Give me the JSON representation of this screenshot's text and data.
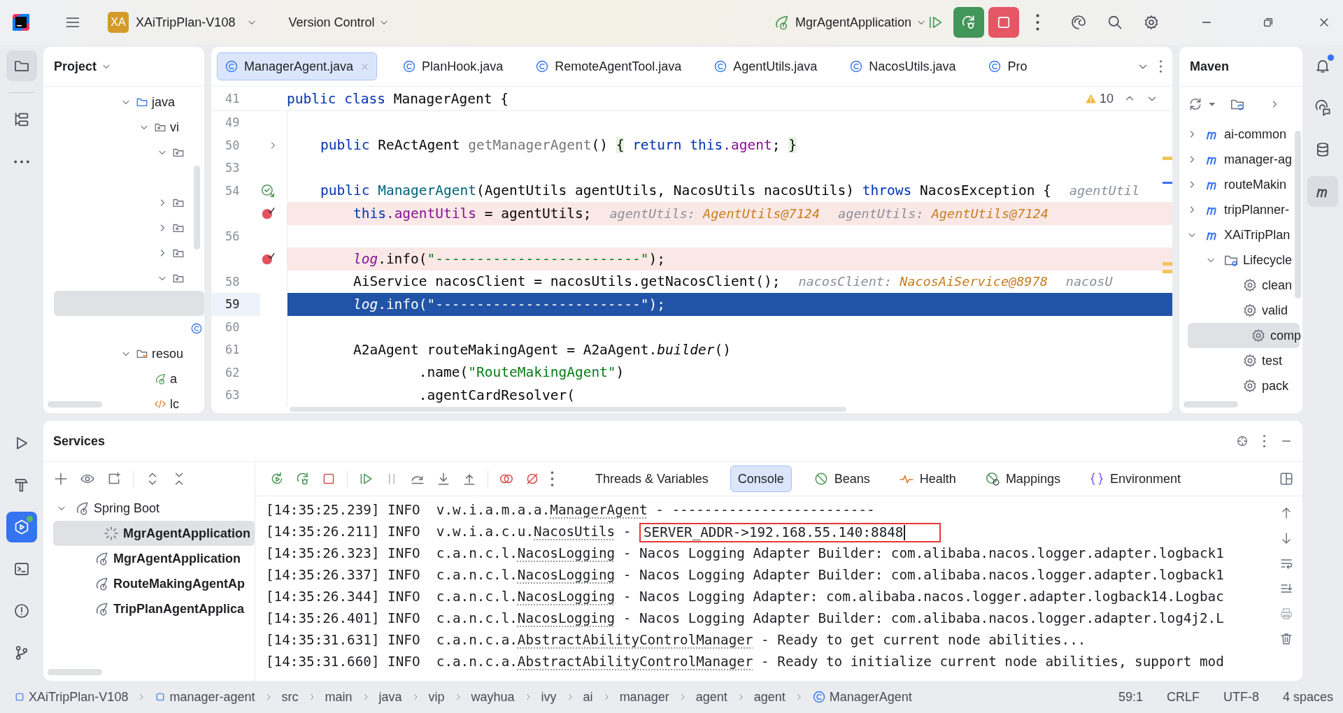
{
  "title_bar": {
    "project_badge": "XA",
    "project": "XAiTripPlan-V108",
    "vcs": "Version Control",
    "run_configuration": "MgrAgentApplication"
  },
  "left_toolbar": {
    "top": [
      {
        "kind": "project",
        "selected": true,
        "badge": false
      },
      {
        "kind": "structure",
        "selected": false,
        "badge": false
      },
      {
        "kind": "more",
        "selected": false,
        "badge": false
      }
    ],
    "bottom": [
      {
        "kind": "run",
        "selected": false,
        "badge": false
      },
      {
        "kind": "build",
        "selected": false,
        "badge": false
      },
      {
        "kind": "services",
        "selected": true,
        "badge": true
      },
      {
        "kind": "terminal",
        "selected": false,
        "badge": false
      },
      {
        "kind": "problems",
        "selected": false,
        "badge": false
      },
      {
        "kind": "git",
        "selected": false,
        "badge": false
      }
    ]
  },
  "right_toolbar": [
    {
      "kind": "notifications",
      "selected": false,
      "badge": true
    },
    {
      "kind": "ai-chat",
      "selected": false,
      "badge": false
    },
    {
      "kind": "database",
      "selected": false,
      "badge": false
    },
    {
      "kind": "maven",
      "selected": true,
      "badge": false
    }
  ],
  "project_panel": {
    "title": "Project",
    "tree": [
      {
        "label": "java",
        "kind": "source-folder",
        "expanded": true,
        "selected": false,
        "children": [
          {
            "label": "vi",
            "kind": "package",
            "expanded": true,
            "selected": false,
            "children": [
              {
                "kind": "package",
                "expanded": true,
                "selected": false,
                "children": [
                  {
                    "selected": false
                  }
                ]
              },
              {
                "kind": "package",
                "expanded": false,
                "selected": false
              },
              {
                "kind": "package",
                "expanded": false,
                "selected": false
              },
              {
                "kind": "package",
                "expanded": false,
                "selected": false
              },
              {
                "kind": "package",
                "expanded": true,
                "selected": false,
                "children": [
                  {
                    "selected": true
                  },
                  {
                    "kind": "class",
                    "selected": false
                  }
                ]
              }
            ]
          }
        ]
      },
      {
        "label": "resou",
        "kind": "resource-folder",
        "expanded": true,
        "selected": false,
        "children": [
          {
            "label": "a",
            "kind": "spring-config",
            "selected": false
          },
          {
            "label": "lc",
            "kind": "xml",
            "selected": false
          }
        ]
      }
    ]
  },
  "editor": {
    "tabs": [
      {
        "label": "ManagerAgent.java",
        "selected": true
      },
      {
        "label": "PlanHook.java",
        "selected": false
      },
      {
        "label": "RemoteAgentTool.java",
        "selected": false
      },
      {
        "label": "AgentUtils.java",
        "selected": false
      },
      {
        "label": "NacosUtils.java",
        "selected": false
      },
      {
        "label": "Pro",
        "selected": false
      }
    ],
    "warnings": "10",
    "sticky_line": {
      "number": "41",
      "code": [
        {
          "kind": "keyword",
          "text": "public"
        },
        {
          "kind": "keyword",
          "text": " class"
        },
        {
          "kind": "plain",
          "text": " ManagerAgent {"
        }
      ]
    },
    "lines": [
      {
        "number": "49",
        "breakpoint": false,
        "execution_point": false
      },
      {
        "number": "50",
        "breakpoint": false,
        "execution_point": false,
        "gutter_icon": {
          "kind": "fold"
        },
        "code": [
          {
            "kind": "keyword",
            "text": "    public"
          },
          {
            "kind": "plain",
            "text": " ReActAgent "
          },
          {
            "kind": "unused",
            "text": "getManagerAgent"
          },
          {
            "kind": "plain",
            "text": "() "
          },
          {
            "kind": "fold",
            "text": "{"
          },
          {
            "kind": "keyword",
            "text": " return this"
          },
          {
            "kind": "field",
            "text": ".agent"
          },
          {
            "kind": "plain",
            "text": "; "
          },
          {
            "kind": "fold",
            "text": "}"
          }
        ]
      },
      {
        "number": "53",
        "breakpoint": false,
        "execution_point": false
      },
      {
        "number": "54",
        "breakpoint": false,
        "execution_point": false,
        "gutter_icon": {
          "kind": "override"
        },
        "code": [
          {
            "kind": "keyword",
            "text": "    public"
          },
          {
            "kind": "declaration",
            "text": " ManagerAgent"
          },
          {
            "kind": "plain",
            "text": "(AgentUtils agentUtils, NacosUtils nacosUtils) "
          },
          {
            "kind": "keyword",
            "text": "throws"
          },
          {
            "kind": "plain",
            "text": " NacosException {"
          }
        ],
        "hints": [
          {
            "label": "agentUtil"
          }
        ]
      },
      {
        "breakpoint": true,
        "execution_point": false,
        "code": [
          {
            "kind": "keyword",
            "text": "        this"
          },
          {
            "kind": "field",
            "text": ".agentUtils"
          },
          {
            "kind": "plain",
            "text": " = agentUtils;"
          }
        ],
        "hints": [
          {
            "label": "agentUtils:",
            "value": "AgentUtils@7124"
          },
          {
            "label": "agentUtils:",
            "value": "AgentUtils@7124"
          }
        ]
      },
      {
        "number": "56",
        "breakpoint": false,
        "execution_point": false
      },
      {
        "breakpoint": true,
        "execution_point": false,
        "code": [
          {
            "kind": "static",
            "text": "        log"
          },
          {
            "kind": "plain",
            "text": ".info("
          },
          {
            "kind": "string",
            "text": "\"-------------------------\""
          },
          {
            "kind": "plain",
            "text": ");"
          }
        ]
      },
      {
        "number": "58",
        "breakpoint": false,
        "execution_point": false,
        "code": [
          {
            "kind": "plain",
            "text": "        AiService nacosClient = nacosUtils.getNacosClient();"
          }
        ],
        "hints": [
          {
            "label": "nacosClient:",
            "value": "NacosAiService@8978"
          },
          {
            "label": "nacosU"
          }
        ]
      },
      {
        "number": "59",
        "breakpoint": false,
        "execution_point": true,
        "code": [
          {
            "kind": "static",
            "text": "        log"
          },
          {
            "kind": "plain",
            "text": ".info("
          },
          {
            "kind": "string",
            "text": "\"-------------------------\""
          },
          {
            "kind": "plain",
            "text": ");"
          }
        ]
      },
      {
        "number": "60",
        "breakpoint": false,
        "execution_point": false
      },
      {
        "number": "61",
        "breakpoint": false,
        "execution_point": false,
        "code": [
          {
            "kind": "plain",
            "text": "        A2aAgent routeMakingAgent = A2aAgent."
          },
          {
            "kind": "italic",
            "text": "builder"
          },
          {
            "kind": "plain",
            "text": "()"
          }
        ]
      },
      {
        "number": "62",
        "breakpoint": false,
        "execution_point": false,
        "code": [
          {
            "kind": "plain",
            "text": "                .name("
          },
          {
            "kind": "string",
            "text": "\"RouteMakingAgent\""
          },
          {
            "kind": "plain",
            "text": ")"
          }
        ]
      },
      {
        "number": "63",
        "breakpoint": false,
        "execution_point": false,
        "code": [
          {
            "kind": "plain",
            "text": "                .agentCardResolver("
          }
        ]
      }
    ]
  },
  "maven_panel": {
    "title": "Maven",
    "tree": [
      {
        "label": "ai-common",
        "kind": "module",
        "expanded": false,
        "selected": false
      },
      {
        "label": "manager-ag",
        "kind": "module",
        "expanded": false,
        "selected": false
      },
      {
        "label": "routeMakin",
        "kind": "module",
        "expanded": false,
        "selected": false
      },
      {
        "label": "tripPlanner-",
        "kind": "module",
        "expanded": false,
        "selected": false
      },
      {
        "label": "XAiTripPlan",
        "kind": "module",
        "expanded": true,
        "selected": false,
        "children": [
          {
            "label": "Lifecycle",
            "kind": "lifecycle",
            "expanded": true,
            "selected": false,
            "children": [
              {
                "label": "clean",
                "kind": "goal",
                "selected": false
              },
              {
                "label": "valid",
                "kind": "goal",
                "selected": false
              },
              {
                "label": "comp",
                "kind": "goal",
                "selected": true
              },
              {
                "label": "test",
                "kind": "goal",
                "selected": false
              },
              {
                "label": "pack",
                "kind": "goal",
                "selected": false
              }
            ]
          }
        ]
      }
    ]
  },
  "services_panel": {
    "title": "Services",
    "tree": [
      {
        "label": "Spring Boot",
        "kind": "spring-group",
        "expanded": true,
        "selected": false,
        "children": [
          {
            "label": "MgrAgentApplication",
            "kind": "app-running",
            "selected": true
          },
          {
            "label": "MgrAgentApplication",
            "kind": "app",
            "selected": false
          },
          {
            "label": "RouteMakingAgentAp",
            "kind": "app",
            "selected": false
          },
          {
            "label": "TripPlanAgentApplica",
            "kind": "app",
            "selected": false
          }
        ]
      }
    ],
    "console_tabs": [
      {
        "label": "Threads & Variables",
        "kind": "threads",
        "selected": false
      },
      {
        "label": "Console",
        "kind": "console",
        "selected": true
      },
      {
        "label": "Beans",
        "kind": "beans",
        "selected": false
      },
      {
        "label": "Health",
        "kind": "health",
        "selected": false
      },
      {
        "label": "Mappings",
        "kind": "mappings",
        "selected": false
      },
      {
        "label": "Environment",
        "kind": "environment",
        "selected": false
      }
    ],
    "console": [
      {
        "prefix": "[14:35:25.239] INFO  v.w.i.a.m.a.a.",
        "link": "ManagerAgent",
        "separator": " - ",
        "message": "-------------------------",
        "boxed": false
      },
      {
        "prefix": "[14:35:26.211] INFO  v.w.i.a.c.u.",
        "link": "NacosUtils",
        "separator": " - ",
        "message": "SERVER_ADDR->192.168.55.140:8848",
        "boxed": true
      },
      {
        "prefix": "[14:35:26.323] INFO  c.a.n.c.l.",
        "link": "NacosLogging",
        "separator": " - ",
        "message": "Nacos Logging Adapter Builder: com.alibaba.nacos.logger.adapter.logback1",
        "boxed": false
      },
      {
        "prefix": "[14:35:26.337] INFO  c.a.n.c.l.",
        "link": "NacosLogging",
        "separator": " - ",
        "message": "Nacos Logging Adapter Builder: com.alibaba.nacos.logger.adapter.logback1",
        "boxed": false
      },
      {
        "prefix": "[14:35:26.344] INFO  c.a.n.c.l.",
        "link": "NacosLogging",
        "separator": " - ",
        "message": "Nacos Logging Adapter: com.alibaba.nacos.logger.adapter.logback14.Logbac",
        "boxed": false
      },
      {
        "prefix": "[14:35:26.401] INFO  c.a.n.c.l.",
        "link": "NacosLogging",
        "separator": " - ",
        "message": "Nacos Logging Adapter Builder: com.alibaba.nacos.logger.adapter.log4j2.L",
        "boxed": false
      },
      {
        "prefix": "[14:35:31.631] INFO  c.a.n.c.a.",
        "link": "AbstractAbilityControlManager",
        "separator": " - ",
        "message": "Ready to get current node abilities...",
        "boxed": false
      },
      {
        "prefix": "[14:35:31.660] INFO  c.a.n.c.a.",
        "link": "AbstractAbilityControlManager",
        "separator": " - ",
        "message": "Ready to initialize current node abilities, support mod",
        "boxed": false
      }
    ]
  },
  "status_bar": {
    "breadcrumbs": [
      {
        "label": "XAiTripPlan-V108",
        "kind": "module"
      },
      {
        "label": "manager-agent",
        "kind": "module"
      },
      {
        "label": "src"
      },
      {
        "label": "main"
      },
      {
        "label": "java"
      },
      {
        "label": "vip"
      },
      {
        "label": "wayhua"
      },
      {
        "label": "ivy"
      },
      {
        "label": "ai"
      },
      {
        "label": "manager"
      },
      {
        "label": "agent"
      },
      {
        "label": "agent"
      },
      {
        "label": "ManagerAgent",
        "kind": "class"
      }
    ],
    "position": "59:1",
    "line_separator": "CRLF",
    "encoding": "UTF-8",
    "indent": "4 spaces"
  }
}
